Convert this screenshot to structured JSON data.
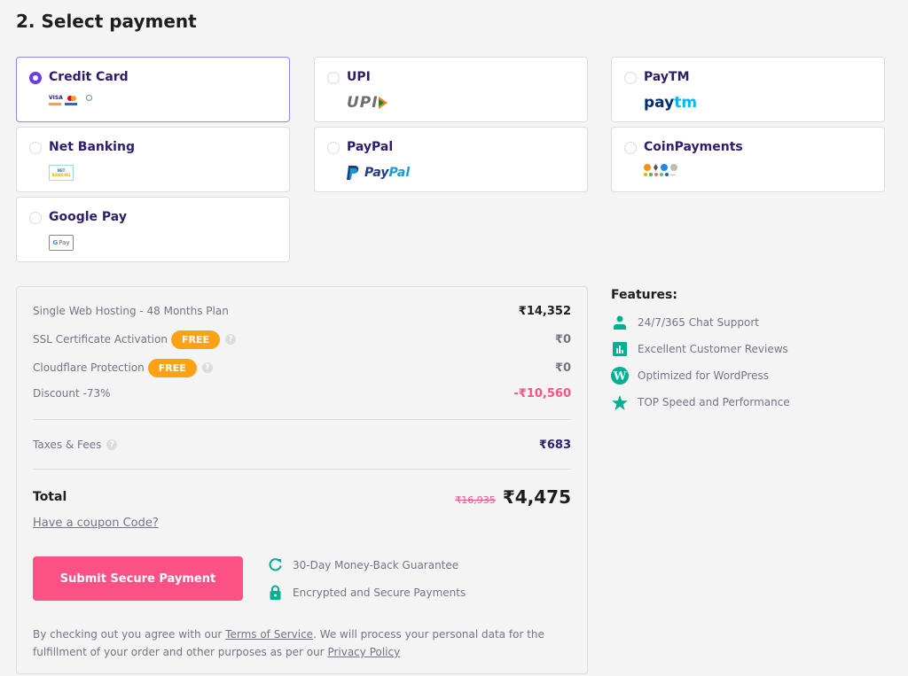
{
  "section_title": "2. Select payment",
  "payment_methods": [
    {
      "label": "Credit Card",
      "selected": true,
      "logo": "card-brands"
    },
    {
      "label": "UPI",
      "selected": false,
      "logo": "upi"
    },
    {
      "label": "PayTM",
      "selected": false,
      "logo": "paytm"
    },
    {
      "label": "Net Banking",
      "selected": false,
      "logo": "net-banking"
    },
    {
      "label": "PayPal",
      "selected": false,
      "logo": "paypal"
    },
    {
      "label": "CoinPayments",
      "selected": false,
      "logo": "crypto-coins"
    },
    {
      "label": "Google Pay",
      "selected": false,
      "logo": "gpay"
    }
  ],
  "logos": {
    "upi_text": "UPI",
    "paytm_pay": "pay",
    "paytm_tm": "tm",
    "netbanking_1": "NET",
    "netbanking_2": "BANKING",
    "paypal_text_1": "Pay",
    "paypal_text_2": "Pal",
    "gpay_g": "G",
    "gpay_pay": "Pay",
    "visa": "VISA"
  },
  "summary": {
    "items": [
      {
        "label": "Single Web Hosting - 48 Months Plan",
        "value": "₹14,352"
      },
      {
        "label": "SSL Certificate Activation",
        "badge": "FREE",
        "value": "₹0"
      },
      {
        "label": "Cloudflare Protection",
        "badge": "FREE",
        "value": "₹0"
      },
      {
        "label": "Discount -73%",
        "value": "-₹10,560"
      }
    ],
    "taxes_label": "Taxes & Fees",
    "taxes_value": "₹683",
    "total_label": "Total",
    "total_old": "₹16,935",
    "total_new": "₹4,475",
    "coupon_link": "Have a coupon Code?",
    "submit_label": "Submit Secure Payment",
    "guarantees": [
      "30-Day Money-Back Guarantee",
      "Encrypted and Secure Payments"
    ],
    "legal_1": "By checking out you agree with our ",
    "legal_tos": "Terms of Service",
    "legal_2": ". We will process your personal data for the fulfillment of your order and other purposes as per our ",
    "legal_privacy": "Privacy Policy"
  },
  "features": {
    "title": "Features:",
    "items": [
      "24/7/365 Chat Support",
      "Excellent Customer Reviews",
      "Optimized for WordPress",
      "TOP Speed and Performance"
    ]
  },
  "colors": {
    "accent": "#673de6",
    "submit": "#fc5185",
    "badge": "#ffa114",
    "discount": "#fc5185",
    "feature_icon": "#00b090"
  }
}
